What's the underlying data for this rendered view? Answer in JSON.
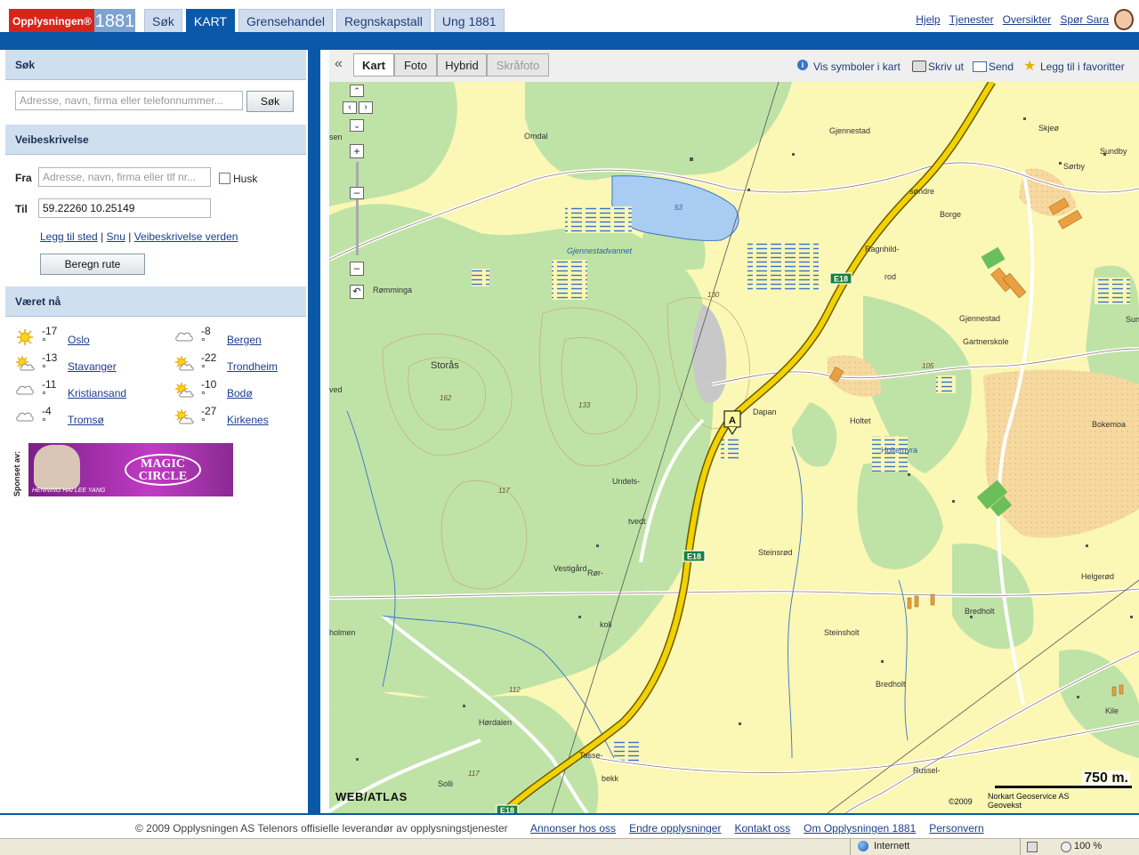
{
  "header": {
    "logo_text": "Opplysningen®",
    "logo_number": "1881",
    "tabs": [
      "Søk",
      "KART",
      "Grensehandel",
      "Regnskapstall",
      "Ung 1881"
    ],
    "active_tab": "KART",
    "links": [
      "Hjelp",
      "Tjenester",
      "Oversikter",
      "Spør Sara"
    ]
  },
  "sidebar": {
    "search": {
      "heading": "Søk",
      "placeholder": "Adresse, navn, firma eller telefonnummer...",
      "button": "Søk"
    },
    "route": {
      "heading": "Veibeskrivelse",
      "from_label": "Fra",
      "from_placeholder": "Adresse, navn, firma eller tlf nr...",
      "remember_label": "Husk",
      "to_label": "Til",
      "to_value": "59.22260 10.25149",
      "link_add": "Legg til sted",
      "link_reverse": "Snu",
      "link_world": "Veibeskrivelse verden",
      "separator": "|",
      "calc_button": "Beregn rute"
    },
    "weather": {
      "heading": "Været nå",
      "items": [
        {
          "city": "Oslo",
          "temp": "-17",
          "icon": "sun-icon"
        },
        {
          "city": "Bergen",
          "temp": "-8",
          "icon": "cloud-icon"
        },
        {
          "city": "Stavanger",
          "temp": "-13",
          "icon": "sun-cloud-icon"
        },
        {
          "city": "Trondheim",
          "temp": "-22",
          "icon": "sun-cloud-icon"
        },
        {
          "city": "Kristiansand",
          "temp": "-11",
          "icon": "cloud-icon"
        },
        {
          "city": "Bodø",
          "temp": "-10",
          "icon": "sun-cloud-icon"
        },
        {
          "city": "Tromsø",
          "temp": "-4",
          "icon": "cloud-icon"
        },
        {
          "city": "Kirkenes",
          "temp": "-27",
          "icon": "sun-cloud-icon"
        }
      ],
      "degree": "°"
    },
    "sponsor": {
      "label": "Sponset av:",
      "brand_line1": "MAGIC",
      "brand_line2": "CIRCLE",
      "caption": "HENNING HAI LEE YANG"
    }
  },
  "map_toolbar": {
    "collapse": "«",
    "tabs": [
      "Kart",
      "Foto",
      "Hybrid",
      "Skråfoto"
    ],
    "active_tab": "Kart",
    "disabled_tab": "Skråfoto",
    "links": [
      "Vis symboler i kart",
      "Skriv ut",
      "Send",
      "Legg til i favoritter"
    ]
  },
  "map": {
    "place_labels": [
      "Omdal",
      "Gjennestad",
      "Skjeø",
      "Sundby",
      "Sørby",
      "søndre",
      "Borge",
      "Gjennestadvannet",
      "Rømminga",
      "Ragnhild-",
      "rod",
      "Gjennestad",
      "Gartnerskole",
      "Storås",
      "Dapan",
      "Holtet",
      "Holtemyra",
      "Bokemoa",
      "Undels-",
      "tvedt",
      "Vestigård",
      "Rør-",
      "koll",
      "Steinsrød",
      "Helgerød",
      "Bredholt",
      "Steinsholt",
      "Bredholt",
      "Hørdalen",
      "Tasse-",
      "bekk",
      "Russel-",
      "Kile",
      "ved",
      "holmen",
      "Solli",
      "sen",
      "Sun"
    ],
    "lake_label": "53",
    "elevations": [
      "130",
      "162",
      "133",
      "117",
      "112",
      "105",
      "117"
    ],
    "road_labels": [
      "E18",
      "E18",
      "E18"
    ],
    "marker": "A",
    "scale": "750 m.",
    "watermark": "WEB/ATLAS",
    "copyright": "©2009",
    "attribution_line1": "Norkart Geoservice AS",
    "attribution_line2": "Geovekst"
  },
  "footer": {
    "copyright": "© 2009 Opplysningen AS Telenors offisielle leverandør av opplysningstjenester",
    "links": [
      "Annonser hos oss",
      "Endre opplysninger",
      "Kontakt oss",
      "Om Opplysningen 1881",
      "Personvern"
    ]
  },
  "statusbar": {
    "zone": "Internett",
    "zoom": "100 %"
  },
  "colors": {
    "brand_blue": "#0a59a9",
    "brand_red": "#d9241b",
    "road_yellow": "#f2d200",
    "forest_green": "#bfe3a7",
    "water_blue": "#a9cdf2"
  }
}
